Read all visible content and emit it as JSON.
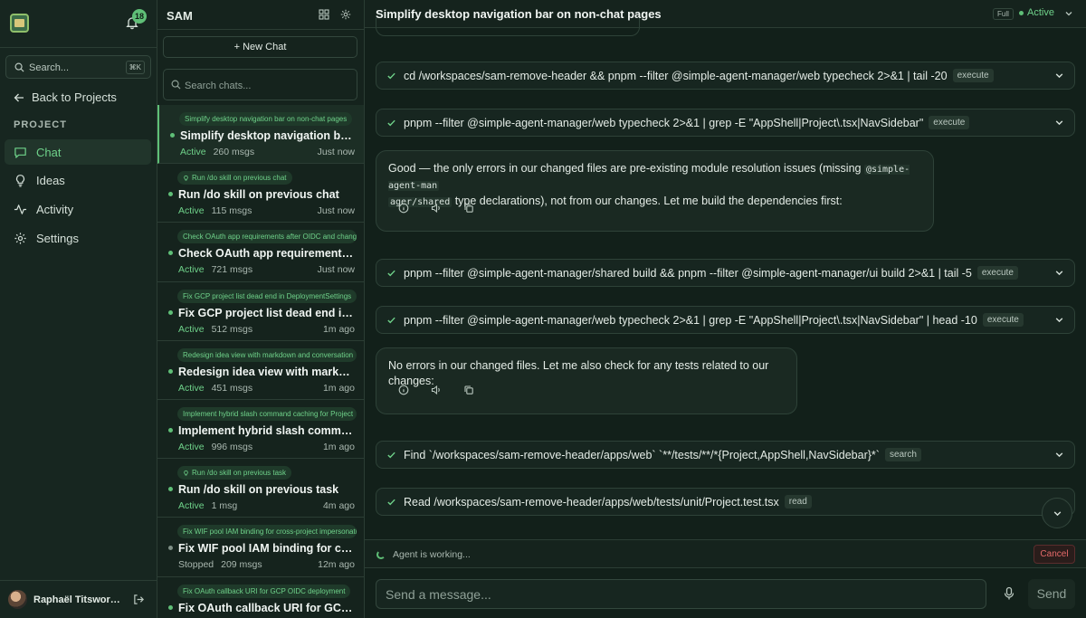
{
  "sidebar": {
    "notification_count": "18",
    "search_placeholder": "Search...",
    "search_shortcut": "⌘K",
    "back_label": "Back to Projects",
    "section_label": "PROJECT",
    "nav": [
      {
        "label": "Chat",
        "icon": "chat-icon",
        "active": true
      },
      {
        "label": "Ideas",
        "icon": "lightbulb-icon"
      },
      {
        "label": "Activity",
        "icon": "activity-icon"
      },
      {
        "label": "Settings",
        "icon": "gear-icon"
      }
    ],
    "user_name": "Raphaël Titsworth-Morin"
  },
  "chatlist": {
    "title": "SAM",
    "new_chat_label": "+ New Chat",
    "search_placeholder": "Search chats...",
    "items": [
      {
        "tag": "Simplify desktop navigation bar on non-chat pages",
        "title": "Simplify desktop navigation bar on non-chat pages",
        "status": "Active",
        "msgs": "260 msgs",
        "time": "Just now"
      },
      {
        "tag": "Run /do skill on previous chat",
        "tag_icon": true,
        "title": "Run /do skill on previous chat",
        "status": "Active",
        "msgs": "115 msgs",
        "time": "Just now"
      },
      {
        "tag": "Check OAuth app requirements after OIDC and changes",
        "title": "Check OAuth app requirements after OIDC and changes",
        "status": "Active",
        "msgs": "721 msgs",
        "time": "Just now"
      },
      {
        "tag": "Fix GCP project list dead end in DeploymentSettings",
        "title": "Fix GCP project list dead end in DeploymentSettings",
        "status": "Active",
        "msgs": "512 msgs",
        "time": "1m ago"
      },
      {
        "tag": "Redesign idea view with markdown and conversation",
        "title": "Redesign idea view with markdown and conversation",
        "status": "Active",
        "msgs": "451 msgs",
        "time": "1m ago"
      },
      {
        "tag": "Implement hybrid slash command caching for Project",
        "title": "Implement hybrid slash command caching for Project",
        "status": "Active",
        "msgs": "996 msgs",
        "time": "1m ago"
      },
      {
        "tag": "Run /do skill on previous task",
        "tag_icon": true,
        "title": "Run /do skill on previous task",
        "status": "Active",
        "msgs": "1 msg",
        "time": "4m ago"
      },
      {
        "tag": "Fix WIF pool IAM binding for cross-project impersonation",
        "title": "Fix WIF pool IAM binding for cross-project impersonation",
        "status": "Stopped",
        "msgs": "209 msgs",
        "time": "12m ago"
      },
      {
        "tag": "Fix OAuth callback URI for GCP OIDC deployment",
        "title": "Fix OAuth callback URI for GCP OIDC deployment",
        "status": "",
        "msgs": "",
        "time": ""
      }
    ]
  },
  "main": {
    "title": "Simplify desktop navigation bar on non-chat pages",
    "mode_badge": "Full",
    "status": "Active",
    "tools": [
      {
        "cmd": "cd /workspaces/sam-remove-header && pnpm --filter @simple-agent-manager/web typecheck 2>&1 | tail -20",
        "kind": "execute"
      },
      {
        "cmd": "pnpm --filter @simple-agent-manager/web typecheck 2>&1 | grep -E \"AppShell|Project\\.tsx|NavSidebar\"",
        "kind": "execute"
      },
      {
        "cmd": "pnpm --filter @simple-agent-manager/shared build && pnpm --filter @simple-agent-manager/ui build 2>&1 | tail -5",
        "kind": "execute"
      },
      {
        "cmd": "pnpm --filter @simple-agent-manager/web typecheck 2>&1 | grep -E \"AppShell|Project\\.tsx|NavSidebar\" | head -10",
        "kind": "execute"
      },
      {
        "cmd": "Find `/workspaces/sam-remove-header/apps/web` `**/tests/**/*{Project,AppShell,NavSidebar}*`",
        "kind": "search"
      },
      {
        "cmd": "Read /workspaces/sam-remove-header/apps/web/tests/unit/Project.test.tsx",
        "kind": "read"
      }
    ],
    "msg1": {
      "line1_pre": "Good — the only errors in our changed files are pre-existing module resolution issues (missing ",
      "code_a": "@simple-agent-man",
      "code_b": "ager/shared",
      "line2_post": " type declarations), not from our changes. Let me build the dependencies first:"
    },
    "msg2": "No errors in our changed files. Let me also check for any tests related to our changes:",
    "working_text": "Agent is working...",
    "cancel_label": "Cancel",
    "composer_placeholder": "Send a message...",
    "send_label": "Send"
  }
}
